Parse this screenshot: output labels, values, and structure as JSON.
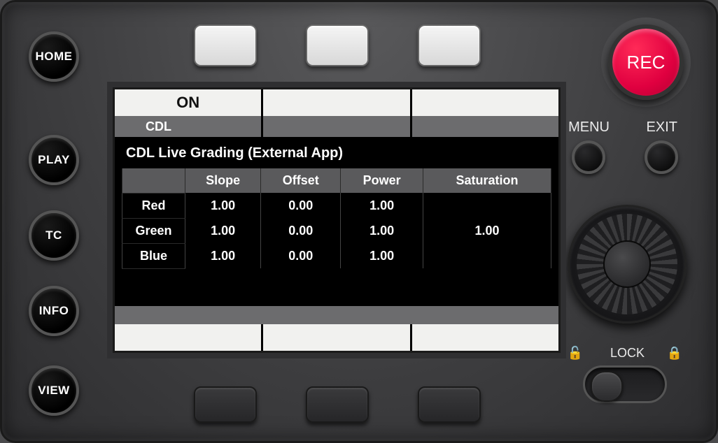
{
  "hardware": {
    "home": "HOME",
    "play": "PLAY",
    "tc": "TC",
    "info": "INFO",
    "view": "VIEW",
    "rec": "REC",
    "menu": "MENU",
    "exit": "EXIT",
    "lock": "LOCK"
  },
  "screen": {
    "topSoft": {
      "s1": "ON",
      "s2": "",
      "s3": ""
    },
    "tab": "CDL",
    "title": "CDL Live Grading  (External App)",
    "columns": {
      "c1": "Slope",
      "c2": "Offset",
      "c3": "Power",
      "c4": "Saturation"
    },
    "rows": {
      "red": {
        "label": "Red",
        "slope": "1.00",
        "offset": "0.00",
        "power": "1.00"
      },
      "green": {
        "label": "Green",
        "slope": "1.00",
        "offset": "0.00",
        "power": "1.00"
      },
      "blue": {
        "label": "Blue",
        "slope": "1.00",
        "offset": "0.00",
        "power": "1.00"
      }
    },
    "saturation": "1.00",
    "bottomSoft": {
      "s1": "",
      "s2": "",
      "s3": ""
    }
  }
}
